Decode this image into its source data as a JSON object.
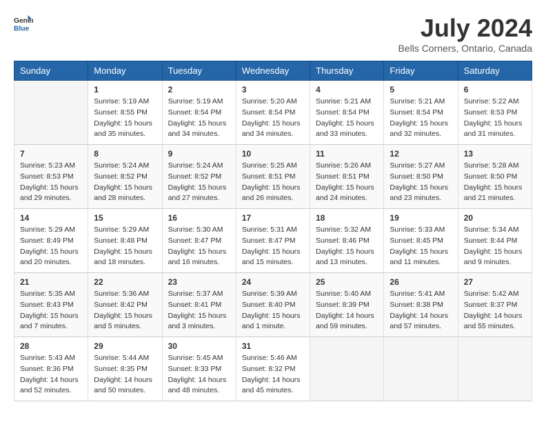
{
  "logo": {
    "general": "General",
    "blue": "Blue"
  },
  "header": {
    "month": "July 2024",
    "location": "Bells Corners, Ontario, Canada"
  },
  "days_of_week": [
    "Sunday",
    "Monday",
    "Tuesday",
    "Wednesday",
    "Thursday",
    "Friday",
    "Saturday"
  ],
  "weeks": [
    [
      {
        "day": "",
        "sunrise": "",
        "sunset": "",
        "daylight": ""
      },
      {
        "day": "1",
        "sunrise": "Sunrise: 5:19 AM",
        "sunset": "Sunset: 8:55 PM",
        "daylight": "Daylight: 15 hours and 35 minutes."
      },
      {
        "day": "2",
        "sunrise": "Sunrise: 5:19 AM",
        "sunset": "Sunset: 8:54 PM",
        "daylight": "Daylight: 15 hours and 34 minutes."
      },
      {
        "day": "3",
        "sunrise": "Sunrise: 5:20 AM",
        "sunset": "Sunset: 8:54 PM",
        "daylight": "Daylight: 15 hours and 34 minutes."
      },
      {
        "day": "4",
        "sunrise": "Sunrise: 5:21 AM",
        "sunset": "Sunset: 8:54 PM",
        "daylight": "Daylight: 15 hours and 33 minutes."
      },
      {
        "day": "5",
        "sunrise": "Sunrise: 5:21 AM",
        "sunset": "Sunset: 8:54 PM",
        "daylight": "Daylight: 15 hours and 32 minutes."
      },
      {
        "day": "6",
        "sunrise": "Sunrise: 5:22 AM",
        "sunset": "Sunset: 8:53 PM",
        "daylight": "Daylight: 15 hours and 31 minutes."
      }
    ],
    [
      {
        "day": "7",
        "sunrise": "Sunrise: 5:23 AM",
        "sunset": "Sunset: 8:53 PM",
        "daylight": "Daylight: 15 hours and 29 minutes."
      },
      {
        "day": "8",
        "sunrise": "Sunrise: 5:24 AM",
        "sunset": "Sunset: 8:52 PM",
        "daylight": "Daylight: 15 hours and 28 minutes."
      },
      {
        "day": "9",
        "sunrise": "Sunrise: 5:24 AM",
        "sunset": "Sunset: 8:52 PM",
        "daylight": "Daylight: 15 hours and 27 minutes."
      },
      {
        "day": "10",
        "sunrise": "Sunrise: 5:25 AM",
        "sunset": "Sunset: 8:51 PM",
        "daylight": "Daylight: 15 hours and 26 minutes."
      },
      {
        "day": "11",
        "sunrise": "Sunrise: 5:26 AM",
        "sunset": "Sunset: 8:51 PM",
        "daylight": "Daylight: 15 hours and 24 minutes."
      },
      {
        "day": "12",
        "sunrise": "Sunrise: 5:27 AM",
        "sunset": "Sunset: 8:50 PM",
        "daylight": "Daylight: 15 hours and 23 minutes."
      },
      {
        "day": "13",
        "sunrise": "Sunrise: 5:28 AM",
        "sunset": "Sunset: 8:50 PM",
        "daylight": "Daylight: 15 hours and 21 minutes."
      }
    ],
    [
      {
        "day": "14",
        "sunrise": "Sunrise: 5:29 AM",
        "sunset": "Sunset: 8:49 PM",
        "daylight": "Daylight: 15 hours and 20 minutes."
      },
      {
        "day": "15",
        "sunrise": "Sunrise: 5:29 AM",
        "sunset": "Sunset: 8:48 PM",
        "daylight": "Daylight: 15 hours and 18 minutes."
      },
      {
        "day": "16",
        "sunrise": "Sunrise: 5:30 AM",
        "sunset": "Sunset: 8:47 PM",
        "daylight": "Daylight: 15 hours and 16 minutes."
      },
      {
        "day": "17",
        "sunrise": "Sunrise: 5:31 AM",
        "sunset": "Sunset: 8:47 PM",
        "daylight": "Daylight: 15 hours and 15 minutes."
      },
      {
        "day": "18",
        "sunrise": "Sunrise: 5:32 AM",
        "sunset": "Sunset: 8:46 PM",
        "daylight": "Daylight: 15 hours and 13 minutes."
      },
      {
        "day": "19",
        "sunrise": "Sunrise: 5:33 AM",
        "sunset": "Sunset: 8:45 PM",
        "daylight": "Daylight: 15 hours and 11 minutes."
      },
      {
        "day": "20",
        "sunrise": "Sunrise: 5:34 AM",
        "sunset": "Sunset: 8:44 PM",
        "daylight": "Daylight: 15 hours and 9 minutes."
      }
    ],
    [
      {
        "day": "21",
        "sunrise": "Sunrise: 5:35 AM",
        "sunset": "Sunset: 8:43 PM",
        "daylight": "Daylight: 15 hours and 7 minutes."
      },
      {
        "day": "22",
        "sunrise": "Sunrise: 5:36 AM",
        "sunset": "Sunset: 8:42 PM",
        "daylight": "Daylight: 15 hours and 5 minutes."
      },
      {
        "day": "23",
        "sunrise": "Sunrise: 5:37 AM",
        "sunset": "Sunset: 8:41 PM",
        "daylight": "Daylight: 15 hours and 3 minutes."
      },
      {
        "day": "24",
        "sunrise": "Sunrise: 5:39 AM",
        "sunset": "Sunset: 8:40 PM",
        "daylight": "Daylight: 15 hours and 1 minute."
      },
      {
        "day": "25",
        "sunrise": "Sunrise: 5:40 AM",
        "sunset": "Sunset: 8:39 PM",
        "daylight": "Daylight: 14 hours and 59 minutes."
      },
      {
        "day": "26",
        "sunrise": "Sunrise: 5:41 AM",
        "sunset": "Sunset: 8:38 PM",
        "daylight": "Daylight: 14 hours and 57 minutes."
      },
      {
        "day": "27",
        "sunrise": "Sunrise: 5:42 AM",
        "sunset": "Sunset: 8:37 PM",
        "daylight": "Daylight: 14 hours and 55 minutes."
      }
    ],
    [
      {
        "day": "28",
        "sunrise": "Sunrise: 5:43 AM",
        "sunset": "Sunset: 8:36 PM",
        "daylight": "Daylight: 14 hours and 52 minutes."
      },
      {
        "day": "29",
        "sunrise": "Sunrise: 5:44 AM",
        "sunset": "Sunset: 8:35 PM",
        "daylight": "Daylight: 14 hours and 50 minutes."
      },
      {
        "day": "30",
        "sunrise": "Sunrise: 5:45 AM",
        "sunset": "Sunset: 8:33 PM",
        "daylight": "Daylight: 14 hours and 48 minutes."
      },
      {
        "day": "31",
        "sunrise": "Sunrise: 5:46 AM",
        "sunset": "Sunset: 8:32 PM",
        "daylight": "Daylight: 14 hours and 45 minutes."
      },
      {
        "day": "",
        "sunrise": "",
        "sunset": "",
        "daylight": ""
      },
      {
        "day": "",
        "sunrise": "",
        "sunset": "",
        "daylight": ""
      },
      {
        "day": "",
        "sunrise": "",
        "sunset": "",
        "daylight": ""
      }
    ]
  ]
}
